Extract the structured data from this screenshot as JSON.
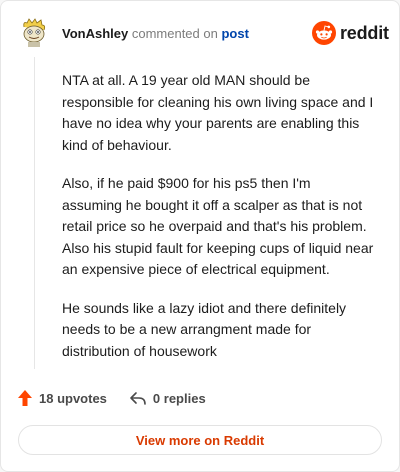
{
  "comment": {
    "username": "VonAshley",
    "action_text": "commented on",
    "post_link": "post",
    "paragraphs": [
      "NTA at all. A 19 year old MAN should be responsible for cleaning his own living space and I have no idea why your parents are enabling this kind of behaviour.",
      "Also, if he paid $900 for his ps5 then I'm assuming he bought it off a scalper as that is not retail price so he overpaid and that's his problem. Also his stupid fault for keeping cups of liquid near an expensive piece of electrical equipment.",
      "He sounds like a lazy idiot and there definitely needs to be a new arrangment made for distribution of housework"
    ]
  },
  "brand": {
    "wordmark": "reddit",
    "color": "#ff4500"
  },
  "actions": {
    "upvotes": "18 upvotes",
    "replies": "0 replies"
  },
  "footer": {
    "view_more": "View more on Reddit"
  },
  "icons": {
    "avatar": "snoo-avatar-icon",
    "logo": "reddit-logo-icon",
    "upvote": "upvote-arrow-icon",
    "reply": "reply-icon"
  }
}
